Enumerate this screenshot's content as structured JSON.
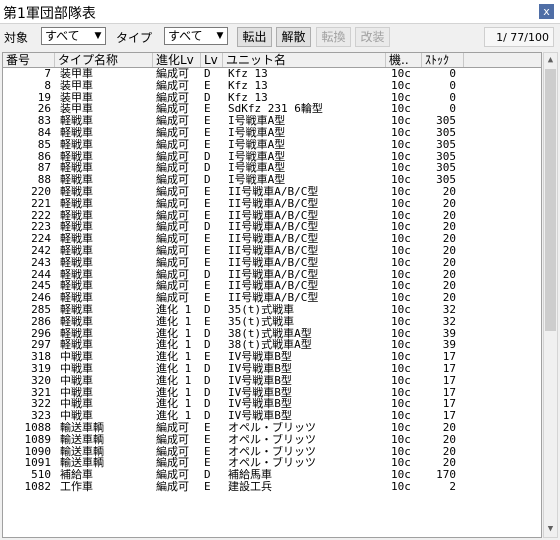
{
  "window": {
    "title": "第1軍団部隊表",
    "close_glyph": "x"
  },
  "toolbar": {
    "target_label": "対象",
    "target_value": "すべて",
    "type_label": "タイプ",
    "type_value": "すべて",
    "transfer_button": "転出",
    "disband_button": "解散",
    "convert_button": "転換",
    "upgrade_button": "改装",
    "page_indicator": "1/ 77/100"
  },
  "table": {
    "headers": [
      "番号",
      "タイプ名称",
      "進化Lv",
      "Lv",
      "ユニット名",
      "機..",
      "ｽﾄｯｸ"
    ],
    "rows": [
      {
        "no": "7",
        "type": "装甲車",
        "evo": "編成可",
        "lv": "D",
        "unit": "Kfz 13",
        "mob": "10c",
        "stock": "0"
      },
      {
        "no": "8",
        "type": "装甲車",
        "evo": "編成可",
        "lv": "E",
        "unit": "Kfz 13",
        "mob": "10c",
        "stock": "0"
      },
      {
        "no": "19",
        "type": "装甲車",
        "evo": "編成可",
        "lv": "D",
        "unit": "Kfz 13",
        "mob": "10c",
        "stock": "0"
      },
      {
        "no": "26",
        "type": "装甲車",
        "evo": "編成可",
        "lv": "E",
        "unit": "SdKfz 231 6輪型",
        "mob": "10c",
        "stock": "0"
      },
      {
        "no": "83",
        "type": "軽戦車",
        "evo": "編成可",
        "lv": "E",
        "unit": "I号戦車A型",
        "mob": "10c",
        "stock": "305"
      },
      {
        "no": "84",
        "type": "軽戦車",
        "evo": "編成可",
        "lv": "E",
        "unit": "I号戦車A型",
        "mob": "10c",
        "stock": "305"
      },
      {
        "no": "85",
        "type": "軽戦車",
        "evo": "編成可",
        "lv": "E",
        "unit": "I号戦車A型",
        "mob": "10c",
        "stock": "305"
      },
      {
        "no": "86",
        "type": "軽戦車",
        "evo": "編成可",
        "lv": "D",
        "unit": "I号戦車A型",
        "mob": "10c",
        "stock": "305"
      },
      {
        "no": "87",
        "type": "軽戦車",
        "evo": "編成可",
        "lv": "D",
        "unit": "I号戦車A型",
        "mob": "10c",
        "stock": "305"
      },
      {
        "no": "88",
        "type": "軽戦車",
        "evo": "編成可",
        "lv": "D",
        "unit": "I号戦車A型",
        "mob": "10c",
        "stock": "305"
      },
      {
        "no": "220",
        "type": "軽戦車",
        "evo": "編成可",
        "lv": "E",
        "unit": "II号戦車A/B/C型",
        "mob": "10c",
        "stock": "20"
      },
      {
        "no": "221",
        "type": "軽戦車",
        "evo": "編成可",
        "lv": "E",
        "unit": "II号戦車A/B/C型",
        "mob": "10c",
        "stock": "20"
      },
      {
        "no": "222",
        "type": "軽戦車",
        "evo": "編成可",
        "lv": "E",
        "unit": "II号戦車A/B/C型",
        "mob": "10c",
        "stock": "20"
      },
      {
        "no": "223",
        "type": "軽戦車",
        "evo": "編成可",
        "lv": "D",
        "unit": "II号戦車A/B/C型",
        "mob": "10c",
        "stock": "20"
      },
      {
        "no": "224",
        "type": "軽戦車",
        "evo": "編成可",
        "lv": "E",
        "unit": "II号戦車A/B/C型",
        "mob": "10c",
        "stock": "20"
      },
      {
        "no": "242",
        "type": "軽戦車",
        "evo": "編成可",
        "lv": "E",
        "unit": "II号戦車A/B/C型",
        "mob": "10c",
        "stock": "20"
      },
      {
        "no": "243",
        "type": "軽戦車",
        "evo": "編成可",
        "lv": "E",
        "unit": "II号戦車A/B/C型",
        "mob": "10c",
        "stock": "20"
      },
      {
        "no": "244",
        "type": "軽戦車",
        "evo": "編成可",
        "lv": "D",
        "unit": "II号戦車A/B/C型",
        "mob": "10c",
        "stock": "20"
      },
      {
        "no": "245",
        "type": "軽戦車",
        "evo": "編成可",
        "lv": "E",
        "unit": "II号戦車A/B/C型",
        "mob": "10c",
        "stock": "20"
      },
      {
        "no": "246",
        "type": "軽戦車",
        "evo": "編成可",
        "lv": "E",
        "unit": "II号戦車A/B/C型",
        "mob": "10c",
        "stock": "20"
      },
      {
        "no": "285",
        "type": "軽戦車",
        "evo": "進化 1",
        "lv": "D",
        "unit": "35(t)式戦車",
        "mob": "10c",
        "stock": "32"
      },
      {
        "no": "286",
        "type": "軽戦車",
        "evo": "進化 1",
        "lv": "E",
        "unit": "35(t)式戦車",
        "mob": "10c",
        "stock": "32"
      },
      {
        "no": "296",
        "type": "軽戦車",
        "evo": "進化 1",
        "lv": "D",
        "unit": "38(t)式戦車A型",
        "mob": "10c",
        "stock": "39"
      },
      {
        "no": "297",
        "type": "軽戦車",
        "evo": "進化 1",
        "lv": "D",
        "unit": "38(t)式戦車A型",
        "mob": "10c",
        "stock": "39"
      },
      {
        "no": "318",
        "type": "中戦車",
        "evo": "進化 1",
        "lv": "E",
        "unit": "IV号戦車B型",
        "mob": "10c",
        "stock": "17"
      },
      {
        "no": "319",
        "type": "中戦車",
        "evo": "進化 1",
        "lv": "D",
        "unit": "IV号戦車B型",
        "mob": "10c",
        "stock": "17"
      },
      {
        "no": "320",
        "type": "中戦車",
        "evo": "進化 1",
        "lv": "D",
        "unit": "IV号戦車B型",
        "mob": "10c",
        "stock": "17"
      },
      {
        "no": "321",
        "type": "中戦車",
        "evo": "進化 1",
        "lv": "D",
        "unit": "IV号戦車B型",
        "mob": "10c",
        "stock": "17"
      },
      {
        "no": "322",
        "type": "中戦車",
        "evo": "進化 1",
        "lv": "D",
        "unit": "IV号戦車B型",
        "mob": "10c",
        "stock": "17"
      },
      {
        "no": "323",
        "type": "中戦車",
        "evo": "進化 1",
        "lv": "D",
        "unit": "IV号戦車B型",
        "mob": "10c",
        "stock": "17"
      },
      {
        "no": "1088",
        "type": "輸送車輌",
        "evo": "編成可",
        "lv": "E",
        "unit": "オペル・ブリッツ",
        "mob": "10c",
        "stock": "20"
      },
      {
        "no": "1089",
        "type": "輸送車輌",
        "evo": "編成可",
        "lv": "E",
        "unit": "オペル・ブリッツ",
        "mob": "10c",
        "stock": "20"
      },
      {
        "no": "1090",
        "type": "輸送車輌",
        "evo": "編成可",
        "lv": "E",
        "unit": "オペル・ブリッツ",
        "mob": "10c",
        "stock": "20"
      },
      {
        "no": "1091",
        "type": "輸送車輌",
        "evo": "編成可",
        "lv": "E",
        "unit": "オペル・ブリッツ",
        "mob": "10c",
        "stock": "20"
      },
      {
        "no": "510",
        "type": "補給車",
        "evo": "編成可",
        "lv": "D",
        "unit": "補給馬車",
        "mob": "10c",
        "stock": "170"
      },
      {
        "no": "1082",
        "type": "工作車",
        "evo": "編成可",
        "lv": "E",
        "unit": "建設工兵",
        "mob": "10c",
        "stock": "2"
      }
    ]
  }
}
